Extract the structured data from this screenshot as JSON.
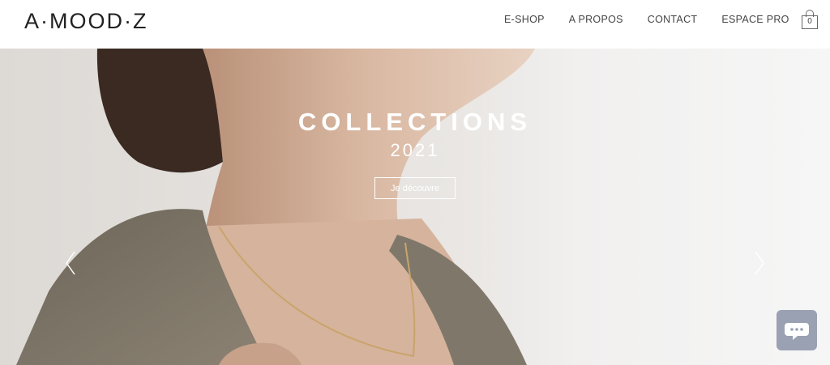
{
  "brand": {
    "logo_text": "A·MOOD·Z"
  },
  "nav": {
    "items": [
      "E-SHOP",
      "A PROPOS",
      "CONTACT",
      "ESPACE PRO"
    ]
  },
  "cart": {
    "count": "0",
    "icon": "shopping-bag-icon"
  },
  "hero": {
    "title": "COLLECTIONS",
    "year": "2021",
    "cta_label": "Je découvre"
  },
  "controls": {
    "prev_icon": "chevron-left-icon",
    "next_icon": "chevron-right-icon",
    "chat_icon": "chat-bubble-icon",
    "chat_color": "#9aa1b3"
  }
}
